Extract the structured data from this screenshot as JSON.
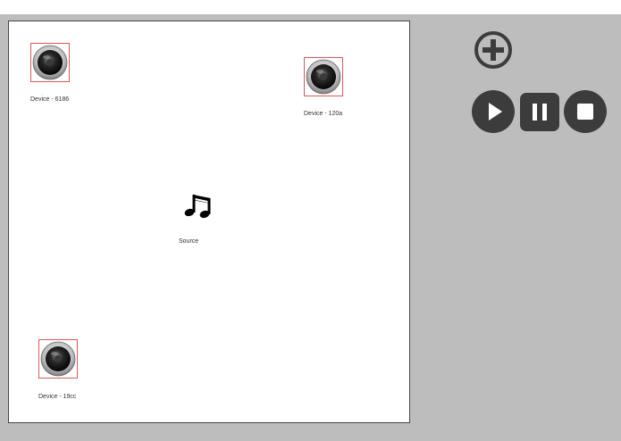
{
  "canvas": {
    "devices": [
      {
        "label": "Device - 6186"
      },
      {
        "label": "Device - 120a"
      },
      {
        "label": "Device - 19cc"
      }
    ],
    "source": {
      "label": "Source",
      "icon": "music-note-icon"
    }
  },
  "controls": {
    "add": {
      "icon": "add-circle-icon"
    },
    "play": {
      "icon": "play-icon"
    },
    "pause": {
      "icon": "pause-icon"
    },
    "stop": {
      "icon": "stop-icon"
    }
  },
  "colors": {
    "panel_bg": "#bdbdbd",
    "control_fill": "#3c3c3c",
    "selection_border": "#e05656"
  }
}
